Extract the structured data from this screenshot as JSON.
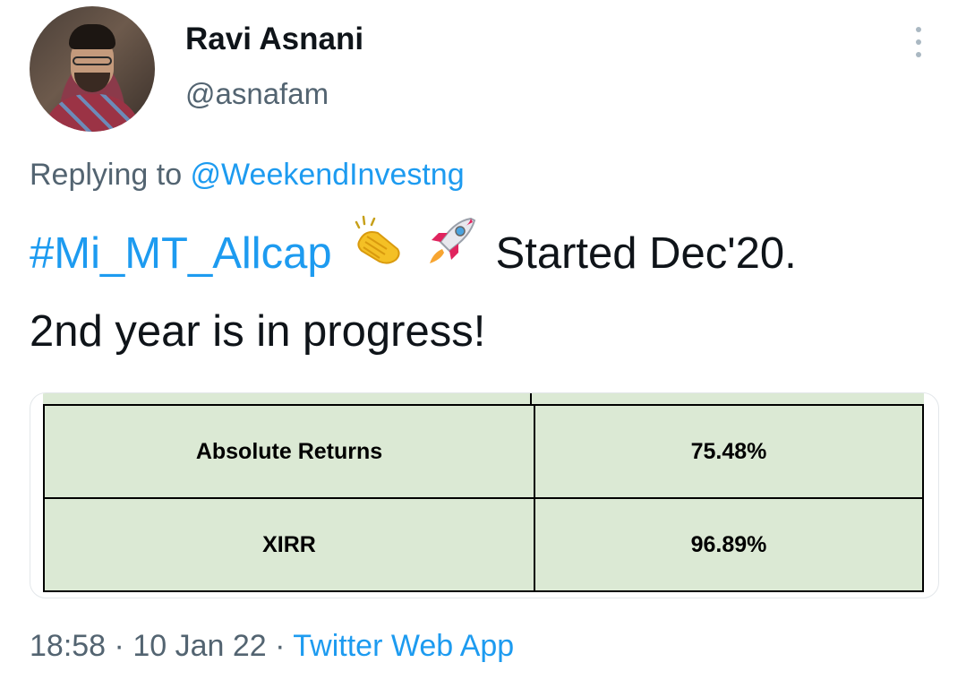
{
  "author": {
    "display_name": "Ravi Asnani",
    "handle": "@asnafam"
  },
  "reply": {
    "prefix": "Replying to ",
    "to_handle": "@WeekendInvestng"
  },
  "tweet": {
    "hashtag": "#Mi_MT_Allcap",
    "emoji_1": "clapping-hands",
    "emoji_2": "rocket",
    "text_after_emojis": " Started Dec'20.",
    "line_2": "2nd year is in progress!"
  },
  "table": {
    "rows": [
      {
        "label": "Absolute Returns",
        "value": "75.48%"
      },
      {
        "label": "XIRR",
        "value": "96.89%"
      }
    ],
    "background_color": "#dbe9d4"
  },
  "footer": {
    "time": "18:58",
    "separator": " · ",
    "date": "10 Jan 22",
    "source": "Twitter Web App"
  },
  "colors": {
    "accent": "#1d9bf0",
    "secondary_text": "#536471",
    "primary_text": "#0f1419"
  }
}
